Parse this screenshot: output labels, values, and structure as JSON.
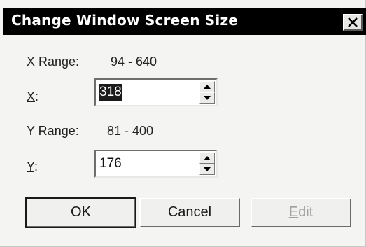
{
  "dialog": {
    "title": "Change Window Screen Size",
    "close_glyph": "✕"
  },
  "x": {
    "range_label": "X Range:",
    "range_value": "94 - 640",
    "field_mnemonic": "X",
    "field_suffix": ":",
    "value": "318"
  },
  "y": {
    "range_label": "Y Range:",
    "range_value": "81 - 400",
    "field_mnemonic": "Y",
    "field_suffix": ":",
    "value": "176"
  },
  "buttons": {
    "ok": "OK",
    "cancel": "Cancel",
    "edit_mnemonic": "E",
    "edit_rest": "dit"
  }
}
